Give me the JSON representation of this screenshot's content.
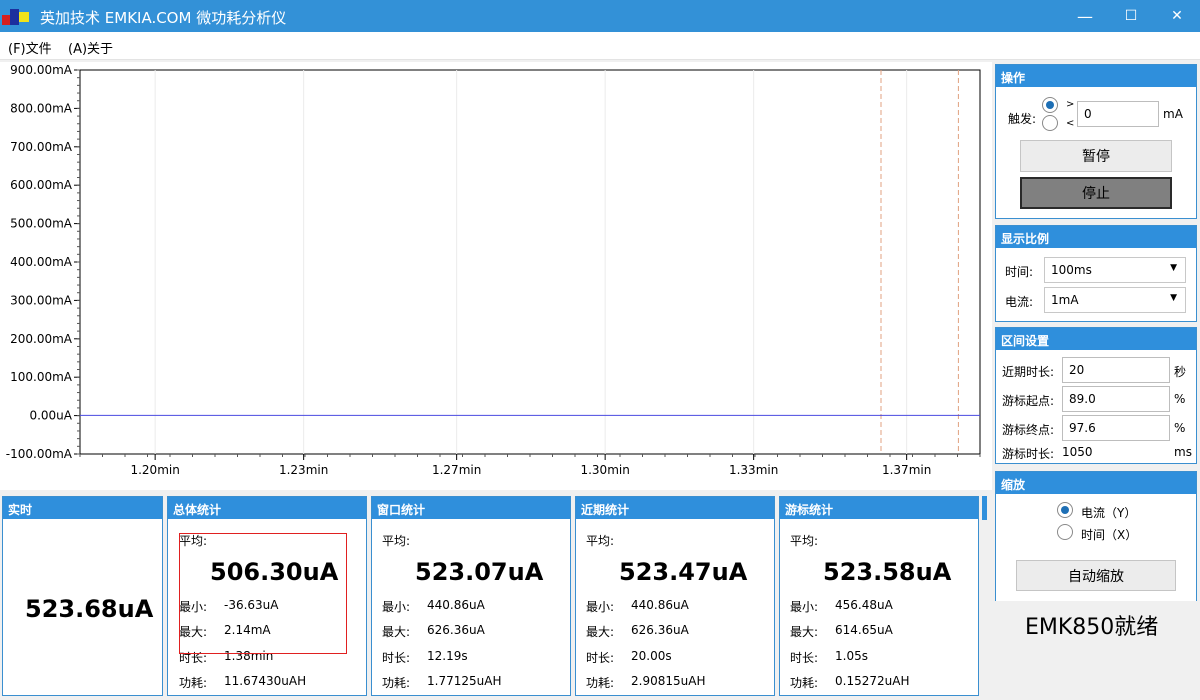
{
  "window": {
    "title": "英加技术 EMKIA.COM 微功耗分析仪",
    "minimize": "—",
    "maximize": "☐",
    "close": "✕"
  },
  "menu": [
    {
      "label": "(F)文件"
    },
    {
      "label": "(A)关于"
    }
  ],
  "chart_data": {
    "type": "line",
    "y_ticks": [
      "900.00mA",
      "800.00mA",
      "700.00mA",
      "600.00mA",
      "500.00mA",
      "400.00mA",
      "300.00mA",
      "200.00mA",
      "100.00mA",
      "0.00uA",
      "-100.00mA"
    ],
    "y_tick_values": [
      900,
      800,
      700,
      600,
      500,
      400,
      300,
      200,
      100,
      0,
      -100
    ],
    "ylim": [
      -100,
      900
    ],
    "x_ticks": [
      "1.20min",
      "1.23min",
      "1.27min",
      "1.30min",
      "1.33min",
      "1.37min"
    ],
    "x_tick_values": [
      1.2,
      1.233,
      1.267,
      1.3,
      1.333,
      1.367
    ],
    "xlim": [
      1.1833,
      1.3833
    ],
    "series": [
      {
        "values_mA": [
          0.5,
          0.5
        ],
        "x": [
          1.1833,
          1.3833
        ],
        "color": "#4a4ae0"
      }
    ],
    "cursors": {
      "start_percent": 89.0,
      "end_percent": 97.6,
      "color": "#e0a080"
    },
    "grid": true
  },
  "operation": {
    "title": "操作",
    "trigger_label": "触发:",
    "gt": ">",
    "lt": "<",
    "trigger_value": "0",
    "unit": "mA",
    "pause": "暂停",
    "stop": "停止"
  },
  "scale": {
    "title": "显示比例",
    "time_label": "时间:",
    "time_value": "100ms",
    "current_label": "电流:",
    "current_value": "1mA"
  },
  "interval": {
    "title": "区间设置",
    "recent_label": "近期时长:",
    "recent_value": "20",
    "recent_unit": "秒",
    "cursor_start_label": "游标起点:",
    "cursor_start_value": "89.0",
    "cursor_start_unit": "%",
    "cursor_end_label": "游标终点:",
    "cursor_end_value": "97.6",
    "cursor_end_unit": "%",
    "cursor_duration_label": "游标时长:",
    "cursor_duration_value": "1050",
    "cursor_duration_unit": "ms"
  },
  "zoom": {
    "title": "缩放",
    "current_option": "电流（Y）",
    "time_option": "时间（X）",
    "auto_button": "自动缩放"
  },
  "status": "EMK850就绪",
  "stats": {
    "realtime": {
      "title": "实时",
      "value": "523.68uA"
    },
    "total": {
      "title": "总体统计",
      "avg_label": "平均:",
      "avg": "506.30uA",
      "min_label": "最小:",
      "min": "-36.63uA",
      "max_label": "最大:",
      "max": "2.14mA",
      "dur_label": "时长:",
      "dur": "1.38min",
      "energy_label": "功耗:",
      "energy": "11.67430uAH"
    },
    "window": {
      "title": "窗口统计",
      "avg_label": "平均:",
      "avg": "523.07uA",
      "min_label": "最小:",
      "min": "440.86uA",
      "max_label": "最大:",
      "max": "626.36uA",
      "dur_label": "时长:",
      "dur": "12.19s",
      "energy_label": "功耗:",
      "energy": "1.77125uAH"
    },
    "recent": {
      "title": "近期统计",
      "avg_label": "平均:",
      "avg": "523.47uA",
      "min_label": "最小:",
      "min": "440.86uA",
      "max_label": "最大:",
      "max": "626.36uA",
      "dur_label": "时长:",
      "dur": "20.00s",
      "energy_label": "功耗:",
      "energy": "2.90815uAH"
    },
    "cursor": {
      "title": "游标统计",
      "avg_label": "平均:",
      "avg": "523.58uA",
      "min_label": "最小:",
      "min": "456.48uA",
      "max_label": "最大:",
      "max": "614.65uA",
      "dur_label": "时长:",
      "dur": "1.05s",
      "energy_label": "功耗:",
      "energy": "0.15272uAH"
    }
  }
}
